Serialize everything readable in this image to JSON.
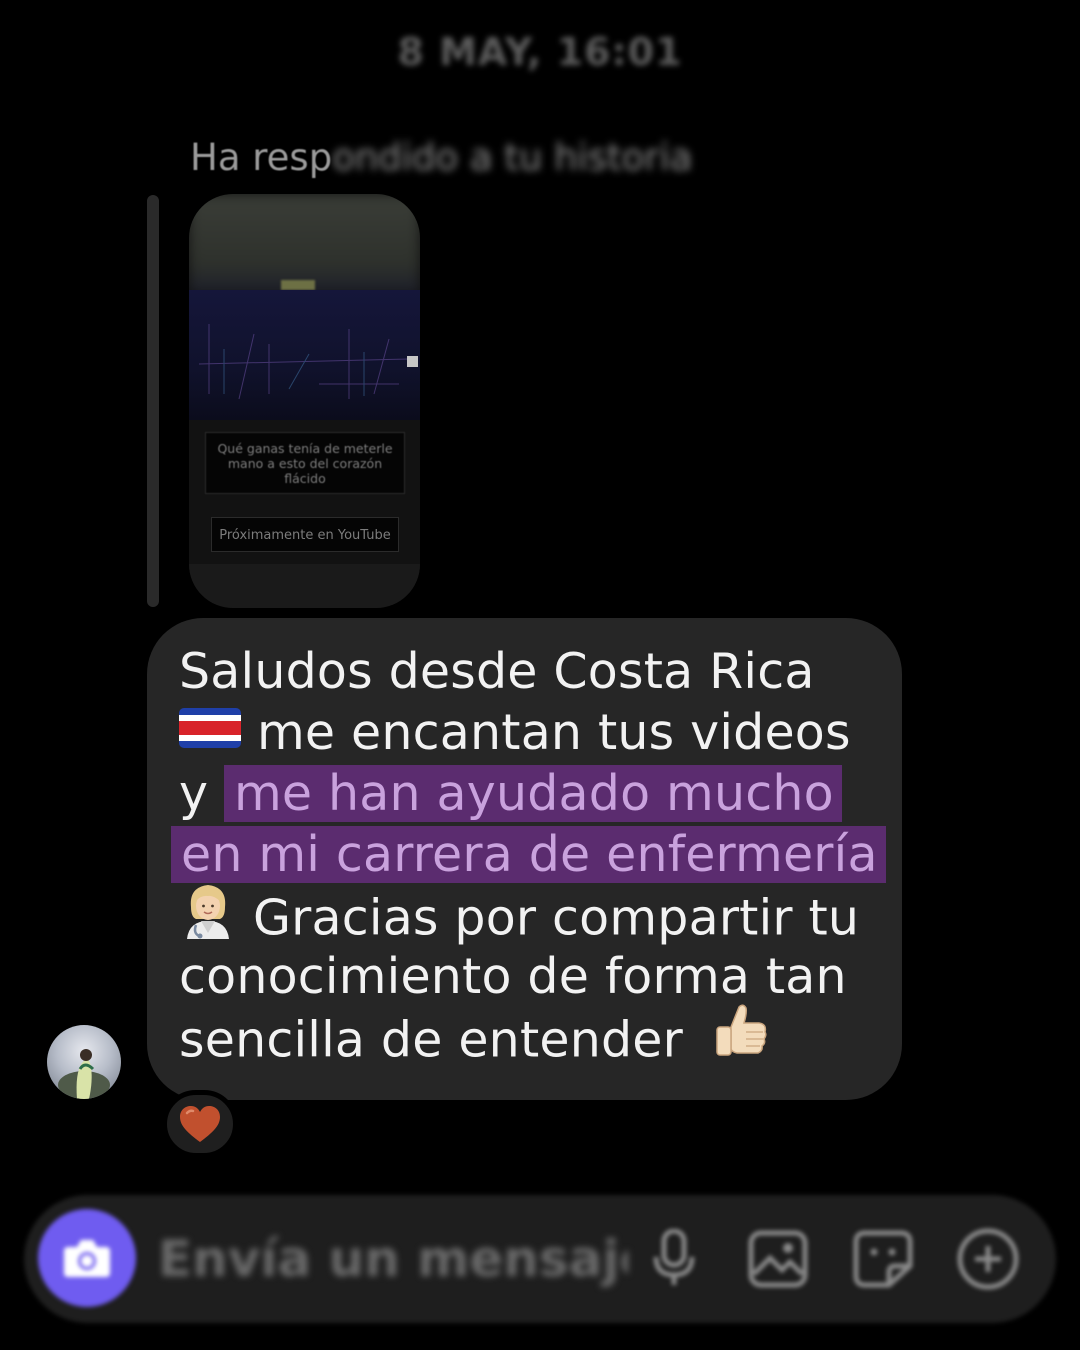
{
  "timestamp": "8 MAY, 16:01",
  "reply": {
    "label_clear": "Ha resp",
    "label_blurred": "ondido a tu historia"
  },
  "story": {
    "caption": "Qué ganas tenía de meterle mano a esto del corazón flácido",
    "pill": "Próximamente en YouTube"
  },
  "message": {
    "lines": [
      {
        "text": "Saludos desde Costa Rica"
      },
      {
        "text": "me encantan tus videos"
      },
      {
        "text": "y",
        "highlight": "me han ayudado mucho"
      },
      {
        "highlight": "en mi carrera de enfermería"
      },
      {
        "text": "Gracias por compartir tu"
      },
      {
        "text": "conocimiento de forma tan"
      },
      {
        "text": "sencilla de entender"
      }
    ]
  },
  "reaction": {
    "icon": "heart-icon",
    "color": "#c1502e"
  },
  "composer": {
    "placeholder": "Envía un mensaje...",
    "accent": "#6f5cf0"
  },
  "icons": {
    "camera": "camera-icon",
    "mic": "microphone-icon",
    "gallery": "gallery-icon",
    "sticker": "sticker-icon",
    "plus": "plus-circle-icon"
  }
}
